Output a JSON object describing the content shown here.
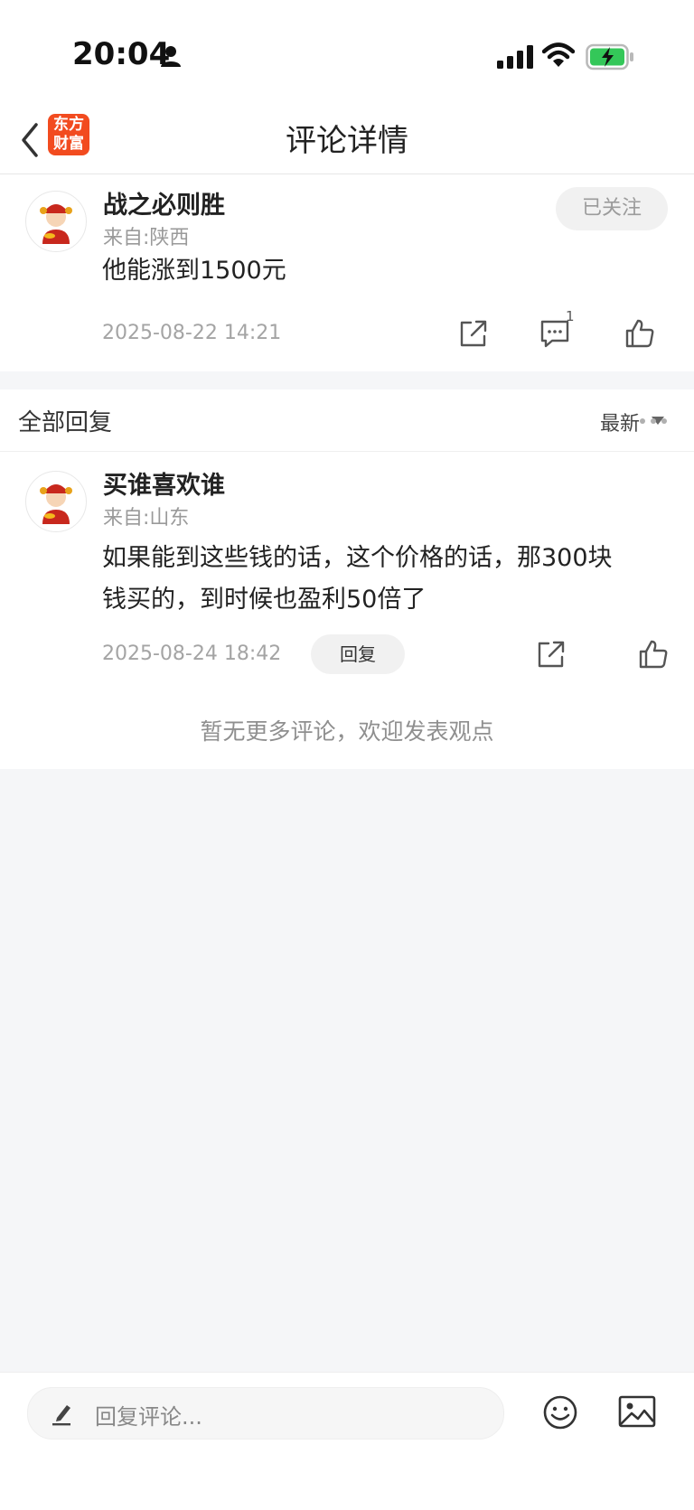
{
  "status_bar": {
    "time": "20:04"
  },
  "nav": {
    "title": "评论详情",
    "logo_line1": "东方",
    "logo_line2": "财富"
  },
  "main_comment": {
    "username": "战之必则胜",
    "location": "来自:陕西",
    "text": "他能涨到1500元",
    "timestamp": "2025-08-22 14:21",
    "follow_label": "已关注",
    "reply_count": "1"
  },
  "replies": {
    "title": "全部回复",
    "sort_label": "最新",
    "items": [
      {
        "username": "买谁喜欢谁",
        "location": "来自:山东",
        "text_line1": "如果能到这些钱的话，这个价格的话，那300块",
        "text_line2": "钱买的，到时候也盈利50倍了",
        "timestamp": "2025-08-24 18:42",
        "reply_label": "回复"
      }
    ],
    "end_text": "暂无更多评论，欢迎发表观点"
  },
  "bottom_bar": {
    "placeholder": "回复评论..."
  },
  "colors": {
    "brand": "#f24b1f",
    "battery": "#34c759"
  }
}
